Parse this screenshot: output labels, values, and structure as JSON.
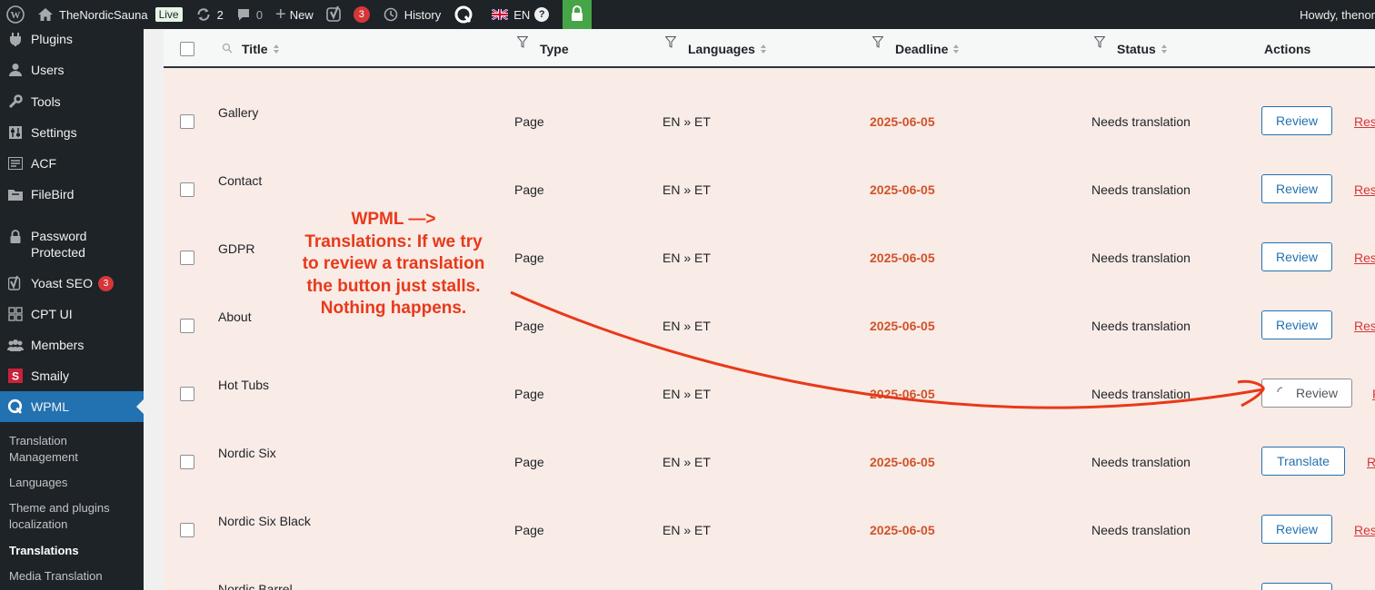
{
  "adminbar": {
    "site_name": "TheNordicSauna",
    "live_label": "Live",
    "updates_count": "2",
    "comments_count": "0",
    "new_label": "New",
    "yoast_count": "3",
    "history_label": "History",
    "language_label": "EN",
    "help_glyph": "?",
    "howdy": "Howdy, thenor"
  },
  "sidebar": {
    "items": [
      {
        "label": "Plugins",
        "icon": "plugin-icon"
      },
      {
        "label": "Users",
        "icon": "user-icon"
      },
      {
        "label": "Tools",
        "icon": "wrench-icon"
      },
      {
        "label": "Settings",
        "icon": "settings-icon"
      },
      {
        "label": "ACF",
        "icon": "acf-icon"
      },
      {
        "label": "FileBird",
        "icon": "folder-icon"
      },
      {
        "label": "Password Protected",
        "icon": "lock-icon"
      },
      {
        "label": "Yoast SEO",
        "icon": "yoast-icon",
        "count": "3"
      },
      {
        "label": "CPT UI",
        "icon": "grid-icon"
      },
      {
        "label": "Members",
        "icon": "members-icon"
      },
      {
        "label": "Smaily",
        "icon": "smaily-icon"
      },
      {
        "label": "WPML",
        "icon": "wpml-icon"
      }
    ],
    "submenu": [
      "Translation Management",
      "Languages",
      "Theme and plugins localization",
      "Translations",
      "Media Translation"
    ]
  },
  "table": {
    "headers": {
      "title": "Title",
      "type": "Type",
      "languages": "Languages",
      "deadline": "Deadline",
      "status": "Status",
      "actions": "Actions"
    },
    "rows": [
      {
        "title": "Gallery",
        "type": "Page",
        "languages": "EN » ET",
        "deadline": "2025-06-05",
        "status": "Needs translation",
        "action": "Review",
        "resend": "Res"
      },
      {
        "title": "Contact",
        "type": "Page",
        "languages": "EN » ET",
        "deadline": "2025-06-05",
        "status": "Needs translation",
        "action": "Review",
        "resend": "Res"
      },
      {
        "title": "GDPR",
        "type": "Page",
        "languages": "EN » ET",
        "deadline": "2025-06-05",
        "status": "Needs translation",
        "action": "Review",
        "resend": "Res"
      },
      {
        "title": "About",
        "type": "Page",
        "languages": "EN » ET",
        "deadline": "2025-06-05",
        "status": "Needs translation",
        "action": "Review",
        "resend": "Res"
      },
      {
        "title": "Hot Tubs",
        "type": "Page",
        "languages": "EN » ET",
        "deadline": "2025-06-05",
        "status": "Needs translation",
        "action": "Review",
        "resend": "R"
      },
      {
        "title": "Nordic Six",
        "type": "Page",
        "languages": "EN » ET",
        "deadline": "2025-06-05",
        "status": "Needs translation",
        "action": "Translate",
        "resend": "R"
      },
      {
        "title": "Nordic Six Black",
        "type": "Page",
        "languages": "EN » ET",
        "deadline": "2025-06-05",
        "status": "Needs translation",
        "action": "Review",
        "resend": "Res"
      },
      {
        "title": "Nordic Barrel",
        "type": "",
        "languages": "",
        "deadline": "",
        "status": "",
        "action": "",
        "resend": ""
      }
    ]
  },
  "annotation": {
    "lines": [
      "WPML —>",
      "Translations: If we try",
      "to review a translation",
      "the button just stalls.",
      "Nothing happens."
    ],
    "color": "#e8391a"
  }
}
